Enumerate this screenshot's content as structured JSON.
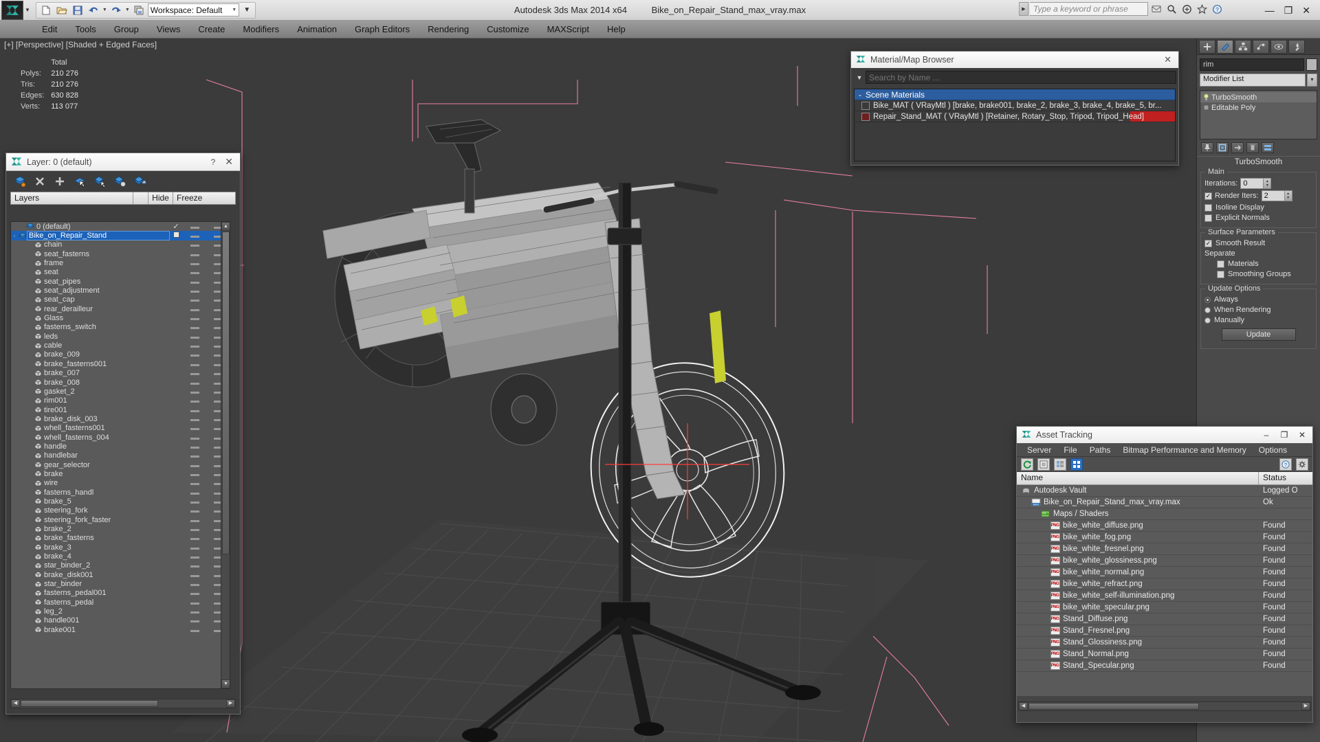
{
  "titlebar": {
    "app_title": "Autodesk 3ds Max  2014 x64",
    "file_title": "Bike_on_Repair_Stand_max_vray.max",
    "workspace_label": "Workspace: Default",
    "search_placeholder": "Type a keyword or phrase",
    "quick_access": [
      "new-file-icon",
      "open-file-icon",
      "save-file-icon",
      "undo-icon",
      "undo-dropdown-icon",
      "redo-icon",
      "redo-dropdown-icon",
      "project-folder-icon"
    ],
    "infocenter_icons": [
      "communication-center-icon",
      "search-icon",
      "help-icon",
      "favorites-icon",
      "subscription-icon"
    ],
    "window_buttons": [
      "minimize",
      "maximize",
      "close"
    ]
  },
  "menubar": {
    "items": [
      "Edit",
      "Tools",
      "Group",
      "Views",
      "Create",
      "Modifiers",
      "Animation",
      "Graph Editors",
      "Rendering",
      "Customize",
      "MAXScript",
      "Help"
    ]
  },
  "viewport": {
    "label": "[+] [Perspective] [Shaded + Edged Faces]",
    "stats": {
      "header": "Total",
      "rows": [
        {
          "label": "Polys:",
          "value": "210 276"
        },
        {
          "label": "Tris:",
          "value": "210 276"
        },
        {
          "label": "Edges:",
          "value": "630 828"
        },
        {
          "label": "Verts:",
          "value": "113 077"
        }
      ]
    }
  },
  "layer_dialog": {
    "title": "Layer: 0 (default)",
    "help_label": "?",
    "close_label": "✕",
    "toolbar_icons": [
      "new-layer-icon",
      "delete-layer-icon",
      "add-layer-icon",
      "select-objects-in-layer-icon",
      "select-highlighted-objects-icon",
      "highlight-selected-objects-icon",
      "hide-unhide-layer-icon"
    ],
    "columns": [
      "Layers",
      "",
      "Hide",
      "Freeze"
    ],
    "rows": [
      {
        "name": "0 (default)",
        "indent": 1,
        "type": "layer",
        "check": "✓",
        "expand": ""
      },
      {
        "name": "Bike_on_Repair_Stand",
        "indent": 0,
        "type": "layer",
        "check": "box",
        "expand": "-",
        "selected": true
      },
      {
        "name": "chain",
        "indent": 2,
        "type": "object"
      },
      {
        "name": "seat_fasterns",
        "indent": 2,
        "type": "object"
      },
      {
        "name": "frame",
        "indent": 2,
        "type": "object"
      },
      {
        "name": "seat",
        "indent": 2,
        "type": "object"
      },
      {
        "name": "seat_pipes",
        "indent": 2,
        "type": "object"
      },
      {
        "name": "seat_adjustment",
        "indent": 2,
        "type": "object"
      },
      {
        "name": "seat_cap",
        "indent": 2,
        "type": "object"
      },
      {
        "name": "rear_derailleur",
        "indent": 2,
        "type": "object"
      },
      {
        "name": "Glass",
        "indent": 2,
        "type": "object"
      },
      {
        "name": "fasterns_switch",
        "indent": 2,
        "type": "object"
      },
      {
        "name": "leds",
        "indent": 2,
        "type": "object"
      },
      {
        "name": "cable",
        "indent": 2,
        "type": "object"
      },
      {
        "name": "brake_009",
        "indent": 2,
        "type": "object"
      },
      {
        "name": "brake_fasterns001",
        "indent": 2,
        "type": "object"
      },
      {
        "name": "brake_007",
        "indent": 2,
        "type": "object"
      },
      {
        "name": "brake_008",
        "indent": 2,
        "type": "object"
      },
      {
        "name": "gasket_2",
        "indent": 2,
        "type": "object"
      },
      {
        "name": "rim001",
        "indent": 2,
        "type": "object"
      },
      {
        "name": "tire001",
        "indent": 2,
        "type": "object"
      },
      {
        "name": "brake_disk_003",
        "indent": 2,
        "type": "object"
      },
      {
        "name": "whell_fasterns001",
        "indent": 2,
        "type": "object"
      },
      {
        "name": "whell_fasterns_004",
        "indent": 2,
        "type": "object"
      },
      {
        "name": "handle",
        "indent": 2,
        "type": "object"
      },
      {
        "name": "handlebar",
        "indent": 2,
        "type": "object"
      },
      {
        "name": "gear_selector",
        "indent": 2,
        "type": "object"
      },
      {
        "name": "brake",
        "indent": 2,
        "type": "object"
      },
      {
        "name": "wire",
        "indent": 2,
        "type": "object"
      },
      {
        "name": "fasterns_handl",
        "indent": 2,
        "type": "object"
      },
      {
        "name": "brake_5",
        "indent": 2,
        "type": "object"
      },
      {
        "name": "steering_fork",
        "indent": 2,
        "type": "object"
      },
      {
        "name": "steering_fork_faster",
        "indent": 2,
        "type": "object"
      },
      {
        "name": "brake_2",
        "indent": 2,
        "type": "object"
      },
      {
        "name": "brake_fasterns",
        "indent": 2,
        "type": "object"
      },
      {
        "name": "brake_3",
        "indent": 2,
        "type": "object"
      },
      {
        "name": "brake_4",
        "indent": 2,
        "type": "object"
      },
      {
        "name": "star_binder_2",
        "indent": 2,
        "type": "object"
      },
      {
        "name": "brake_disk001",
        "indent": 2,
        "type": "object"
      },
      {
        "name": "star_binder",
        "indent": 2,
        "type": "object"
      },
      {
        "name": "fasterns_pedal001",
        "indent": 2,
        "type": "object"
      },
      {
        "name": "fasterns_pedal",
        "indent": 2,
        "type": "object"
      },
      {
        "name": "leg_2",
        "indent": 2,
        "type": "object"
      },
      {
        "name": "handle001",
        "indent": 2,
        "type": "object"
      },
      {
        "name": "brake001",
        "indent": 2,
        "type": "object"
      }
    ]
  },
  "material_browser": {
    "title": "Material/Map Browser",
    "close_label": "✕",
    "search_placeholder": "Search by Name ...",
    "search_value": "",
    "group_label": "Scene Materials",
    "group_sign": "-",
    "items": [
      {
        "name": "Bike_MAT  ( VRayMtl )  [brake, brake001, brake_2, brake_3, brake_4, brake_5, br...",
        "swatch": "#3a3a3a",
        "highlight": false
      },
      {
        "name": "Repair_Stand_MAT  ( VRayMtl )  [Retainer, Rotary_Stop, Tripod, Tripod_Head]",
        "swatch": "#6e1f1f",
        "highlight": true
      }
    ]
  },
  "command_panel": {
    "tabs": [
      "create-tab",
      "modify-tab",
      "hierarchy-tab",
      "motion-tab",
      "display-tab",
      "utilities-tab"
    ],
    "active_tab": 1,
    "object_name": "rim",
    "modifier_list_label": "Modifier List",
    "stack": [
      {
        "label": "TurboSmooth",
        "selected": true
      },
      {
        "label": "Editable Poly",
        "selected": false
      }
    ],
    "stack_buttons": [
      "pin-stack-icon",
      "show-end-result-icon",
      "make-unique-icon",
      "remove-modifier-icon",
      "configure-modifier-sets-icon"
    ],
    "rollout_title": "TurboSmooth",
    "main_group": {
      "title": "Main",
      "iterations_label": "Iterations:",
      "iterations_value": "0",
      "render_iters_label": "Render Iters:",
      "render_iters_value": "2",
      "render_iters_checked": true,
      "isoline_display_label": "Isoline Display",
      "isoline_checked": false,
      "explicit_normals_label": "Explicit Normals",
      "explicit_checked": false
    },
    "surface_group": {
      "title": "Surface Parameters",
      "smooth_result_label": "Smooth Result",
      "smooth_result_checked": true,
      "separate_label": "Separate",
      "materials_label": "Materials",
      "materials_checked": false,
      "smoothing_groups_label": "Smoothing Groups",
      "smoothing_groups_checked": false
    },
    "update_group": {
      "title": "Update Options",
      "options": [
        {
          "label": "Always",
          "selected": true
        },
        {
          "label": "When Rendering",
          "selected": false
        },
        {
          "label": "Manually",
          "selected": false
        }
      ],
      "update_button": "Update"
    }
  },
  "asset_tracking": {
    "title": "Asset Tracking",
    "window_buttons": [
      "–",
      "❐",
      "✕"
    ],
    "menu": [
      "Server",
      "File",
      "Paths",
      "Bitmap Performance and Memory",
      "Options"
    ],
    "toolbar_icons": [
      "refresh-icon",
      "list-view-icon",
      "details-view-icon",
      "thumbnail-view-icon"
    ],
    "toolbar_right_icons": [
      "help-icon",
      "settings-icon"
    ],
    "columns": [
      "Name",
      "Status"
    ],
    "rows": [
      {
        "name": "Autodesk Vault",
        "status": "Logged O",
        "indent": 0,
        "icon": "vault-icon"
      },
      {
        "name": "Bike_on_Repair_Stand_max_vray.max",
        "status": "Ok",
        "indent": 1,
        "icon": "max-file-icon"
      },
      {
        "name": "Maps / Shaders",
        "status": "",
        "indent": 2,
        "icon": "maps-icon"
      },
      {
        "name": "bike_white_diffuse.png",
        "status": "Found",
        "indent": 3,
        "icon": "png-icon"
      },
      {
        "name": "bike_white_fog.png",
        "status": "Found",
        "indent": 3,
        "icon": "png-icon"
      },
      {
        "name": "bike_white_fresnel.png",
        "status": "Found",
        "indent": 3,
        "icon": "png-icon"
      },
      {
        "name": "bike_white_glossiness.png",
        "status": "Found",
        "indent": 3,
        "icon": "png-icon"
      },
      {
        "name": "bike_white_normal.png",
        "status": "Found",
        "indent": 3,
        "icon": "png-icon"
      },
      {
        "name": "bike_white_refract.png",
        "status": "Found",
        "indent": 3,
        "icon": "png-icon"
      },
      {
        "name": "bike_white_self-illumination.png",
        "status": "Found",
        "indent": 3,
        "icon": "png-icon"
      },
      {
        "name": "bike_white_specular.png",
        "status": "Found",
        "indent": 3,
        "icon": "png-icon"
      },
      {
        "name": "Stand_Diffuse.png",
        "status": "Found",
        "indent": 3,
        "icon": "png-icon"
      },
      {
        "name": "Stand_Fresnel.png",
        "status": "Found",
        "indent": 3,
        "icon": "png-icon"
      },
      {
        "name": "Stand_Glossiness.png",
        "status": "Found",
        "indent": 3,
        "icon": "png-icon"
      },
      {
        "name": "Stand_Normal.png",
        "status": "Found",
        "indent": 3,
        "icon": "png-icon"
      },
      {
        "name": "Stand_Specular.png",
        "status": "Found",
        "indent": 3,
        "icon": "png-icon"
      }
    ]
  },
  "colors": {
    "accent_blue": "#2c5d9e",
    "selection_blue": "#1c62b9",
    "status_red": "#c02020",
    "viewport_bg": "#3b3b3b",
    "grid_line": "#4a4a4a",
    "gizmo_pink": "#e8809f"
  }
}
